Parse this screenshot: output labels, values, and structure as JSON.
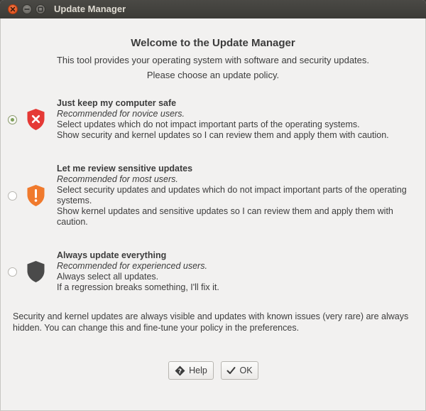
{
  "window": {
    "title": "Update Manager"
  },
  "main": {
    "heading": "Welcome to the Update Manager",
    "intro_line1": "This tool provides your operating system with software and security updates.",
    "intro_line2": "Please choose an update policy."
  },
  "options": [
    {
      "title": "Just keep my computer safe",
      "recommended": "Recommended for novice users.",
      "line1": "Select updates which do not impact important parts of the operating systems.",
      "line2": "Show security and kernel updates so I can review them and apply them with caution.",
      "selected": true,
      "icon": "shield-x-icon",
      "color": "#e53935"
    },
    {
      "title": "Let me review sensitive updates",
      "recommended": "Recommended for most users.",
      "line1": "Select security updates and updates which do not impact important parts of the operating systems.",
      "line2": "Show kernel updates and sensitive updates so I can review them and apply them with caution.",
      "selected": false,
      "icon": "shield-exclamation-icon",
      "color": "#f07a2d"
    },
    {
      "title": "Always update everything",
      "recommended": "Recommended for experienced users.",
      "line1": "Always select all updates.",
      "line2": "If a regression breaks something, I'll fix it.",
      "selected": false,
      "icon": "shield-icon",
      "color": "#4a4a4a"
    }
  ],
  "footer": {
    "note": "Security and kernel updates are always visible and updates with known issues (very rare) are always hidden. You can change this and fine-tune your policy in the preferences."
  },
  "buttons": {
    "help_label": "Help",
    "ok_label": "OK"
  }
}
